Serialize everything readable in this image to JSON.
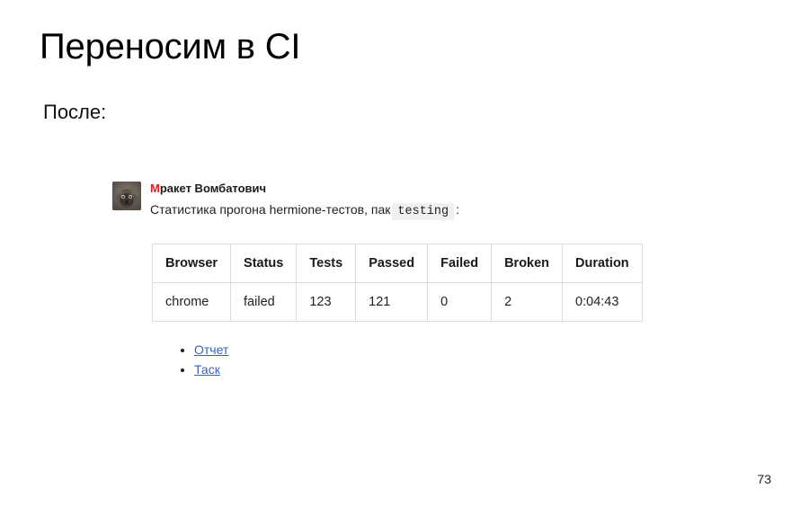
{
  "slide": {
    "title": "Переносим в CI",
    "subtitle": "После:",
    "page_number": "73",
    "background_color": "#ffffff"
  },
  "message": {
    "avatar_icon": "wombat-avatar-photo",
    "sender_initial": "М",
    "sender_name_rest": "ракет Вомбатович",
    "sender_initial_color": "#e02020",
    "text_before_code": "Статистика прогона hermione-тестов, пак",
    "code_chip": "testing",
    "text_after_code": ":"
  },
  "table": {
    "headers": [
      "Browser",
      "Status",
      "Tests",
      "Passed",
      "Failed",
      "Broken",
      "Duration"
    ],
    "rows": [
      {
        "browser": "chrome",
        "status": "failed",
        "tests": "123",
        "passed": "121",
        "failed": "0",
        "broken": "2",
        "duration": "0:04:43"
      }
    ],
    "value_colors": {
      "status_failed": "#ee3333",
      "tests": "#3f83cf",
      "passed": "#2e9e4a",
      "failed": "#ee3333",
      "broken": "#f2c21b",
      "duration": "#1f1f1f",
      "browser": "#1f1f1f"
    },
    "border_color": "#dcdcdc"
  },
  "links": {
    "items": [
      {
        "label": "Отчет"
      },
      {
        "label": "Таск"
      }
    ],
    "color": "#3b5fc0"
  }
}
